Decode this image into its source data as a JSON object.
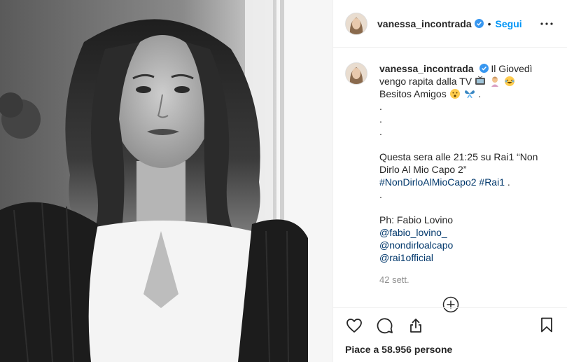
{
  "post": {
    "username": "vanessa_incontrada",
    "follow_label": "Segui",
    "separator": "•",
    "caption": {
      "line1": "Il Giovedì",
      "line2": "vengo rapita dalla TV",
      "line3": "Besitos Amigos",
      "dots": [
        ".",
        ".",
        "."
      ],
      "line4": "Questa sera alle 21:25 su Rai1 “Non",
      "line5": "Dirlo Al Mio Capo 2”",
      "hashtag1": "#NonDirloAlMioCapo2",
      "hashtag2": "#Rai1",
      "hashtag_suffix": " .",
      "dot_after": ".",
      "credit": "Ph: Fabio Lovino",
      "mentions": [
        "@fabio_lovino_",
        "@nondirloalcapo",
        "@rai1official"
      ]
    },
    "timestamp": "42 sett.",
    "likes_text": "Piace a 58.956 persone"
  },
  "icons": {
    "verified": "verified-badge-icon",
    "more": "more-options-icon",
    "like": "heart-icon",
    "comment": "comment-bubble-icon",
    "share": "share-icon",
    "save": "bookmark-icon",
    "load_more": "plus-circle-icon"
  },
  "colors": {
    "accent": "#0095f6",
    "verified": "#3897f0",
    "link": "#00376b",
    "muted": "#8e8e8e",
    "border": "#efefef"
  }
}
